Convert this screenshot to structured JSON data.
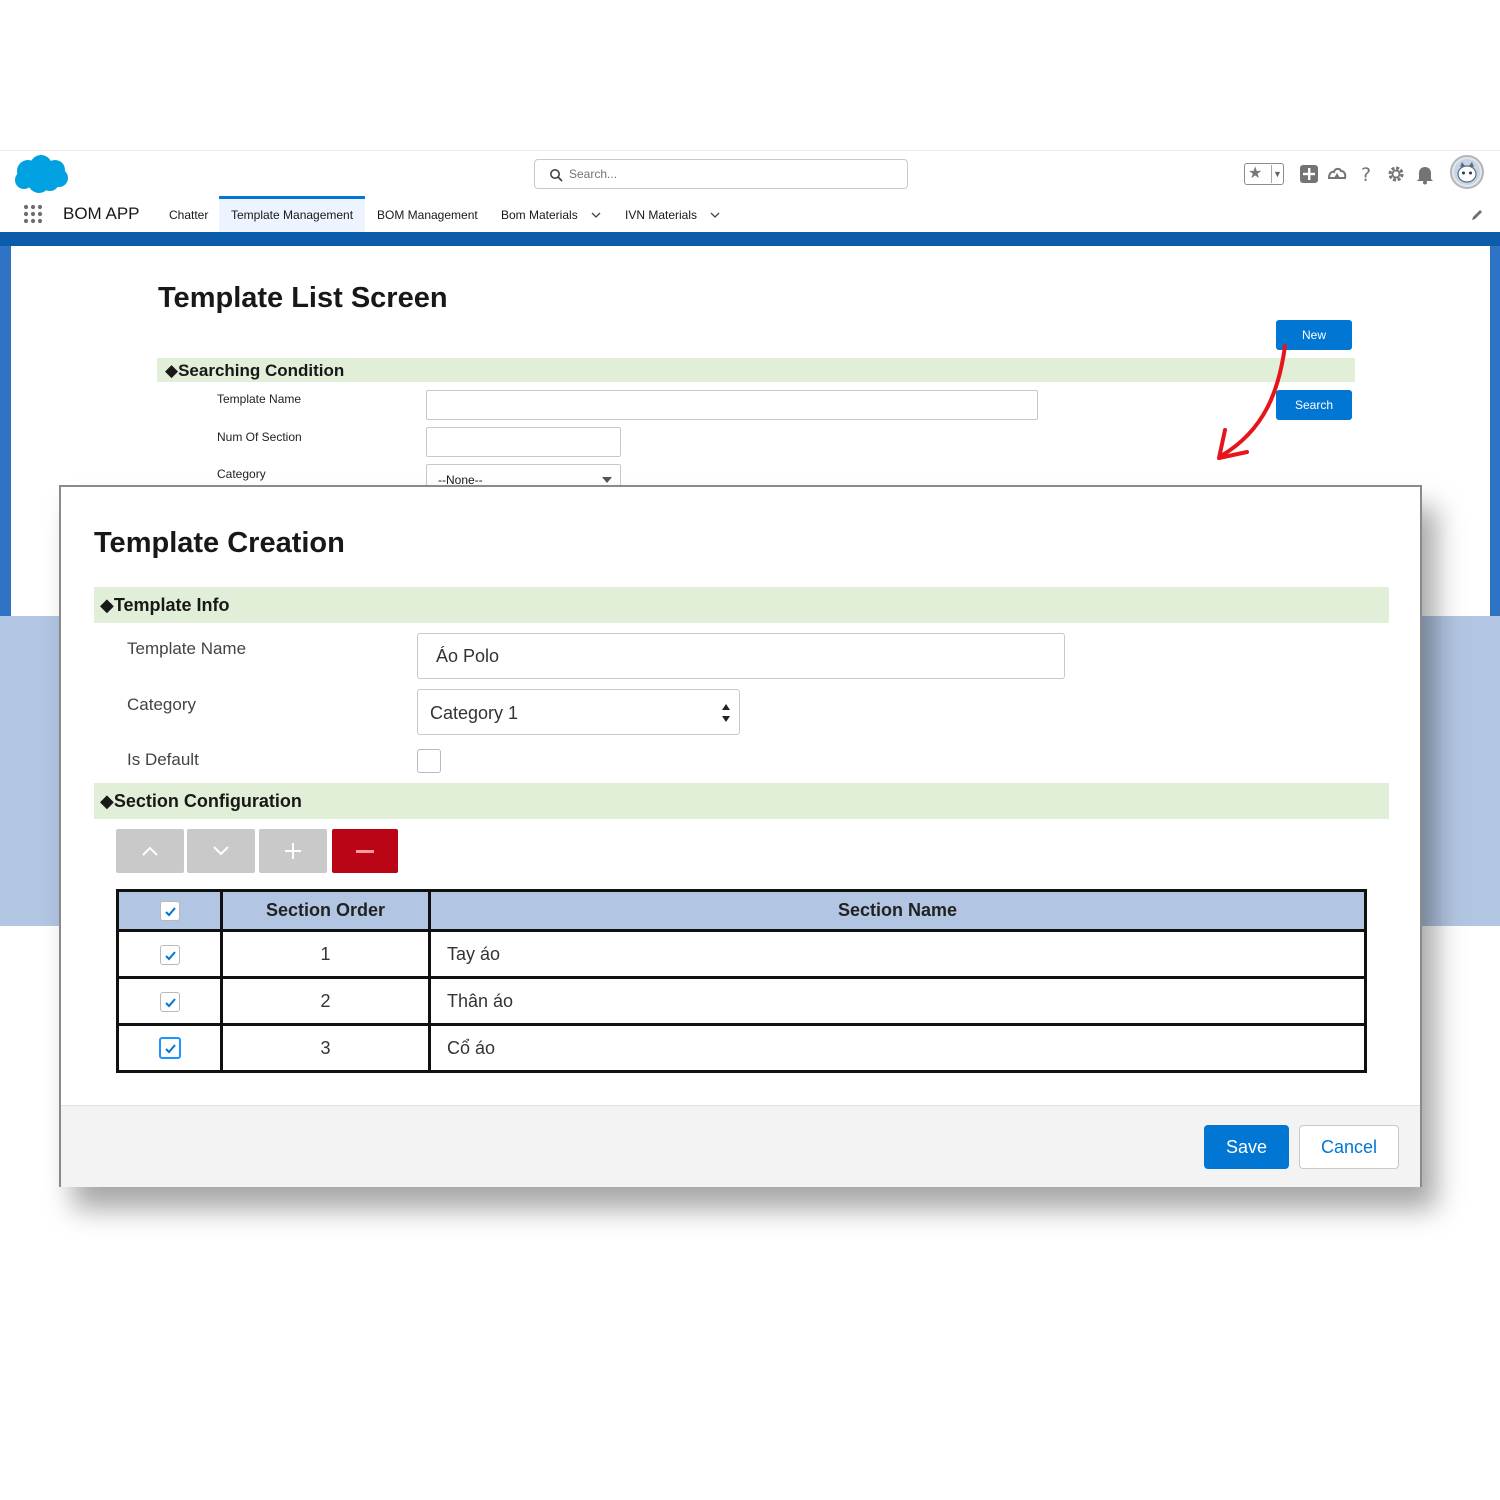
{
  "header": {
    "search_placeholder": "Search...",
    "app_name": "BOM APP",
    "nav_items": [
      "Chatter",
      "Template Management",
      "BOM Management",
      "Bom Materials",
      "IVN Materials"
    ]
  },
  "list_screen": {
    "title": "Template List Screen",
    "new_label": "New",
    "search_label": "Search",
    "section_title": "◆Searching Condition",
    "fields": {
      "template_name": "Template Name",
      "num_of_section": "Num Of Section",
      "category": "Category",
      "category_value": "--None--"
    }
  },
  "modal": {
    "title": "Template Creation",
    "info_section": "◆Template Info",
    "labels": {
      "template_name": "Template Name",
      "category": "Category",
      "is_default": "Is Default"
    },
    "values": {
      "template_name": "Áo Polo",
      "category": "Category 1",
      "is_default": false
    },
    "section_config": "◆Section Configuration",
    "table": {
      "headers": [
        "Section Order",
        "Section Name"
      ],
      "rows": [
        {
          "order": "1",
          "name": "Tay áo",
          "checked": true
        },
        {
          "order": "2",
          "name": "Thân áo",
          "checked": true
        },
        {
          "order": "3",
          "name": "Cổ áo",
          "checked": true
        }
      ]
    },
    "save_label": "Save",
    "cancel_label": "Cancel"
  },
  "colors": {
    "brand_blue": "#0176d3",
    "section_green": "#e1eed8",
    "table_header_blue": "#b2c6e3",
    "delete_red": "#ba0517",
    "arrow_red": "#e8141b"
  }
}
